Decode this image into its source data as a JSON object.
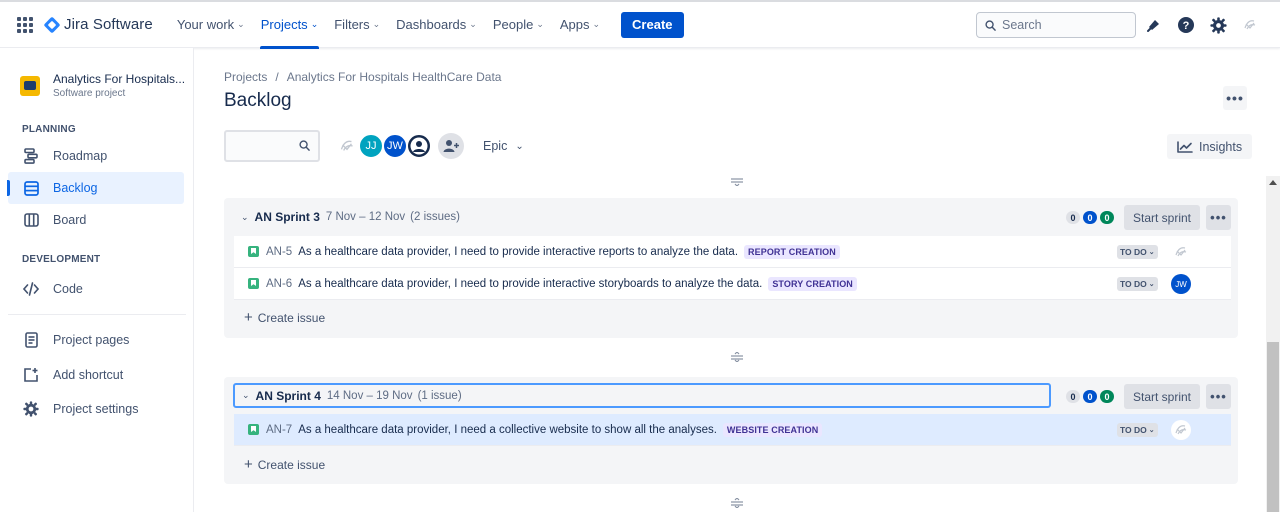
{
  "topnav": {
    "app_name": "Jira Software",
    "items": [
      {
        "label": "Your work",
        "chevron": "⌄"
      },
      {
        "label": "Projects",
        "chevron": "⌄",
        "active": true
      },
      {
        "label": "Filters",
        "chevron": "⌄"
      },
      {
        "label": "Dashboards",
        "chevron": "⌄"
      },
      {
        "label": "People",
        "chevron": "⌄"
      },
      {
        "label": "Apps",
        "chevron": "⌄"
      }
    ],
    "create_label": "Create",
    "search_placeholder": "Search",
    "icons": [
      "app-switcher-icon",
      "notification-icon",
      "help-icon",
      "settings-icon",
      "profile-icon"
    ],
    "accent_color": "#0052CC"
  },
  "sidebar": {
    "project_name": "Analytics For Hospitals...",
    "project_type": "Software project",
    "planning_heading": "PLANNING",
    "development_heading": "DEVELOPMENT",
    "items": [
      {
        "label": "Roadmap",
        "icon": "roadmap-icon"
      },
      {
        "label": "Backlog",
        "icon": "backlog-icon",
        "active": true
      },
      {
        "label": "Board",
        "icon": "board-icon"
      },
      {
        "label": "Code",
        "icon": "code-icon"
      },
      {
        "label": "Project pages",
        "icon": "pages-icon"
      },
      {
        "label": "Add shortcut",
        "icon": "add-shortcut-icon"
      },
      {
        "label": "Project settings",
        "icon": "settings-icon"
      }
    ]
  },
  "main": {
    "breadcrumb": [
      "Projects",
      "/",
      "Analytics For Hospitals HealthCare Data"
    ],
    "title": "Backlog",
    "more_label": "•••",
    "avatars": [
      {
        "initials": "",
        "color": "#FFFFFF"
      },
      {
        "initials": "JJ",
        "color": "#00A3BF"
      },
      {
        "initials": "JW",
        "color": "#0052CC"
      },
      {
        "initials": "",
        "color": "#172B4D"
      }
    ],
    "epic_label": "Epic",
    "epic_chevron": "⌄",
    "insights_label": "Insights"
  },
  "sprints": [
    {
      "chevron": "⌄",
      "name": "AN Sprint 3",
      "dates": "7 Nov – 12 Nov",
      "count": "(2 issues)",
      "todo": "0",
      "in_progress": "0",
      "done": "0",
      "start_label": "Start sprint",
      "more_label": "•••",
      "create_label": "Create issue",
      "issues": [
        {
          "key": "AN-5",
          "summary": "As a healthcare data provider, I need to provide interactive reports to analyze the data.",
          "epic": "REPORT CREATION",
          "epic_bg": "#EAE6FF",
          "epic_fg": "#403294",
          "status": "TO DO",
          "status_chevron": "⌄",
          "assignee": "",
          "assignee_color": "#FFFFFF"
        },
        {
          "key": "AN-6",
          "summary": "As a healthcare data provider, I need to provide interactive storyboards to analyze the data.",
          "epic": "STORY CREATION",
          "epic_bg": "#EAE6FF",
          "epic_fg": "#403294",
          "status": "TO DO",
          "status_chevron": "⌄",
          "assignee": "JW",
          "assignee_color": "#0052CC"
        }
      ]
    },
    {
      "chevron": "⌄",
      "name": "AN Sprint 4",
      "dates": "14 Nov – 19 Nov",
      "count": "(1 issue)",
      "todo": "0",
      "in_progress": "0",
      "done": "0",
      "start_label": "Start sprint",
      "more_label": "•••",
      "create_label": "Create issue",
      "issues": [
        {
          "key": "AN-7",
          "summary": "As a healthcare data provider, I need a collective website to show all the analyses.",
          "epic": "WEBSITE CREATION",
          "epic_bg": "#EAE6FF",
          "epic_fg": "#403294",
          "status": "TO DO",
          "status_chevron": "⌄",
          "assignee": "",
          "assignee_color": "#FFFFFF"
        }
      ]
    }
  ]
}
